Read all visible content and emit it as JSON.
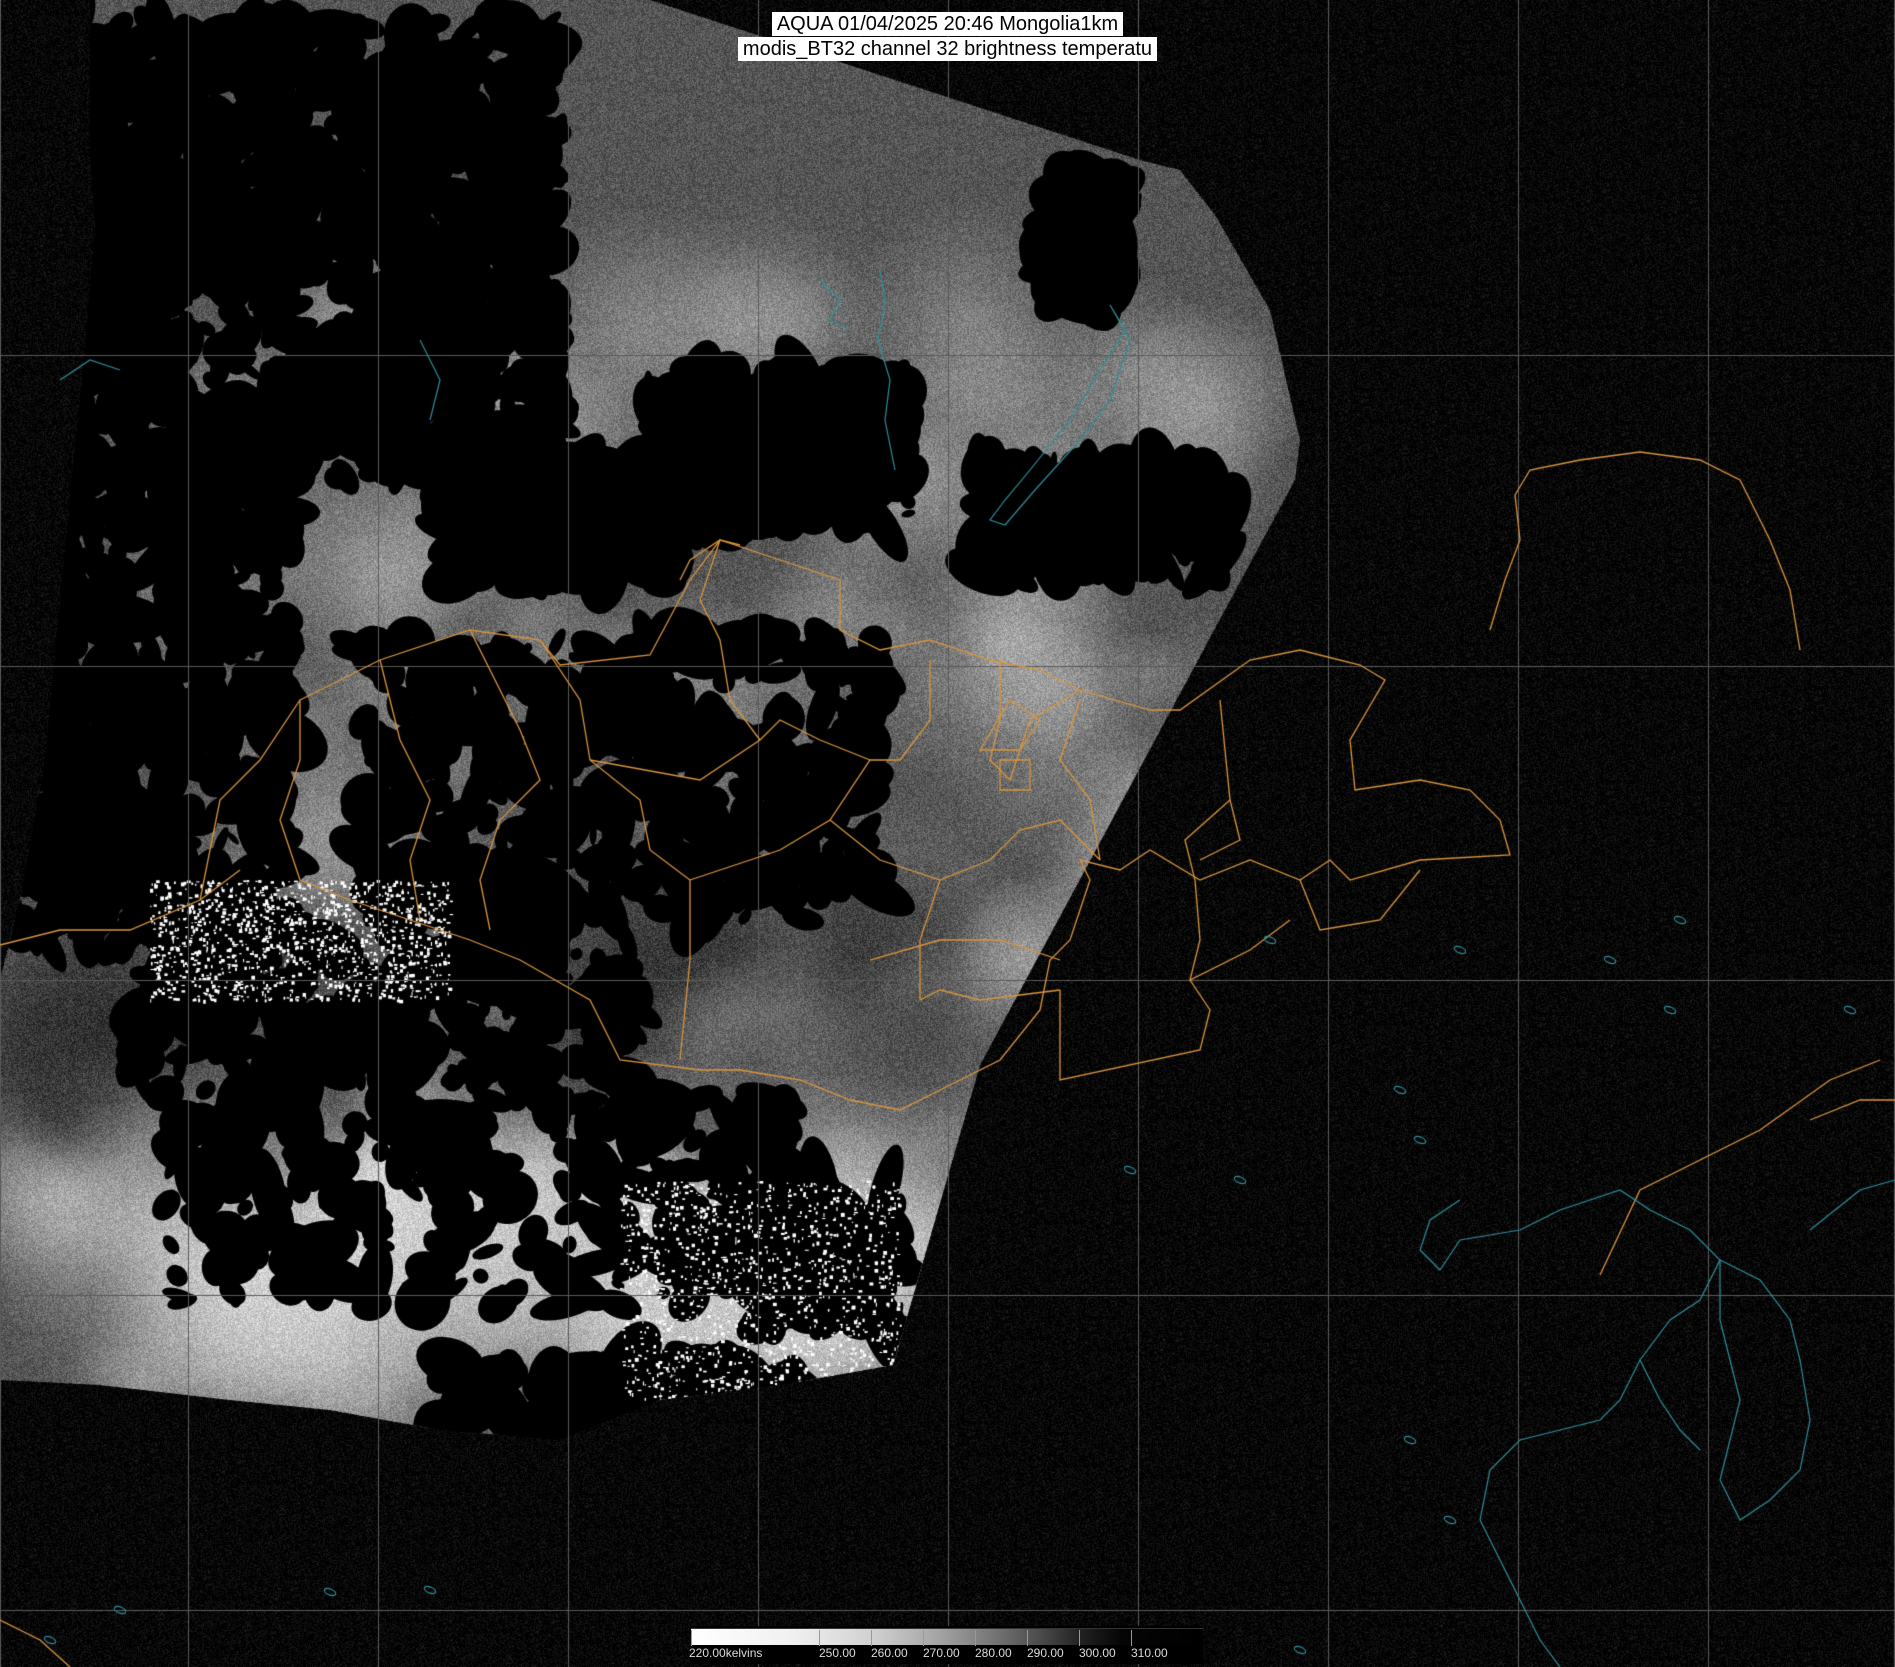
{
  "header": {
    "title_line1": "AQUA 01/04/2025 20:46 Mongolia1km",
    "title_line2": "modis_BT32 channel 32 brightness temperatu"
  },
  "legend": {
    "labels": [
      "220.00kelvins",
      "250.00",
      "260.00",
      "270.00",
      "280.00",
      "290.00",
      "300.00",
      "310.00"
    ],
    "unit": "kelvins",
    "range": [
      220,
      320
    ]
  },
  "colors": {
    "background": "#000000",
    "gridlines": "#5a5a5a",
    "admin_borders": "#d9953d",
    "coastlines": "#2f8e9a",
    "title_box": "#ffffff"
  }
}
